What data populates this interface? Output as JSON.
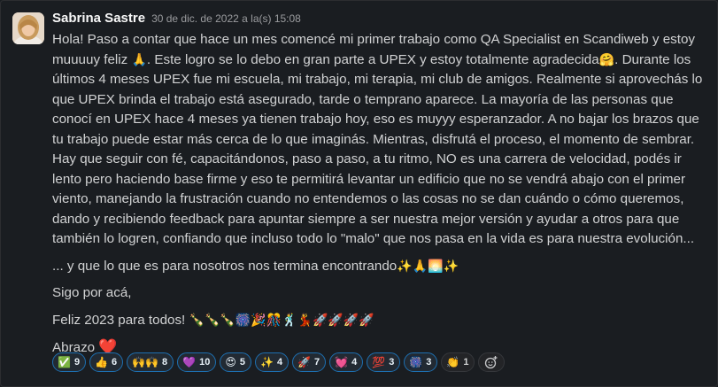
{
  "message": {
    "author": "Sabrina Sastre",
    "timestamp": "30 de dic. de 2022 a la(s) 15:08",
    "paragraph1_a": "Hola! Paso a contar que hace un mes comencé mi primer trabajo como QA Specialist en Scandiweb  y estoy muuuuy feliz ",
    "paragraph1_b": ". Este logro se lo debo en gran parte a UPEX y estoy totalmente agradecida",
    "paragraph1_c": ". Durante los últimos 4 meses UPEX fue mi escuela, mi trabajo, mi terapia, mi club de amigos. Realmente si aprovechás lo que UPEX brinda el trabajo está asegurado, tarde o temprano aparece. La mayoría de las personas que conocí en UPEX hace 4 meses ya tienen trabajo hoy, eso es muyyy esperanzador. A no bajar los brazos que tu trabajo puede estar más cerca de lo que imaginás. Mientras, disfrutá el proceso, el momento de sembrar.  Hay que seguir con fé,  capacitándonos, paso a paso, a tu ritmo, NO es una carrera de velocidad, podés ir lento pero haciendo base firme y eso te permitirá levantar un edificio que no se vendrá abajo con el primer viento, manejando la frustración cuando no entendemos o las cosas no se dan cuándo o cómo queremos,  dando y recibiendo feedback para apuntar siempre a ser nuestra mejor versión y ayudar a otros  para que también lo logren, confiando que incluso todo lo \"malo\" que nos pasa en la vida es para nuestra evolución...",
    "emoji_pray": "🙏",
    "emoji_hug": "🤗",
    "paragraph2": "... y que lo que es para nosotros nos termina encontrando",
    "paragraph2_emojis": "✨🙏🌅✨",
    "paragraph3": "Sigo por acá,",
    "paragraph4": "Feliz 2023 para todos! ",
    "paragraph4_emojis": "🍾🍾🍾🎆🎉🎊🕺💃🚀🚀🚀🚀",
    "paragraph5": "Abrazo ",
    "paragraph5_emoji": "❤️"
  },
  "reactions": [
    {
      "emoji": "✅",
      "count": "9",
      "active": true
    },
    {
      "emoji": "👍",
      "count": "6",
      "active": true
    },
    {
      "emoji": "🙌🙌",
      "count": "8",
      "active": true
    },
    {
      "emoji": "💜",
      "count": "10",
      "active": true
    },
    {
      "emoji": "😍",
      "count": "5",
      "active": true
    },
    {
      "emoji": "✨",
      "count": "4",
      "active": true
    },
    {
      "emoji": "🚀",
      "count": "7",
      "active": true
    },
    {
      "emoji": "💓",
      "count": "4",
      "active": true
    },
    {
      "emoji": "💯",
      "count": "3",
      "active": true
    },
    {
      "emoji": "🎆",
      "count": "3",
      "active": true
    },
    {
      "emoji": "👏",
      "count": "1",
      "active": false
    }
  ],
  "icons": {
    "add_reaction": "add-reaction-icon"
  }
}
